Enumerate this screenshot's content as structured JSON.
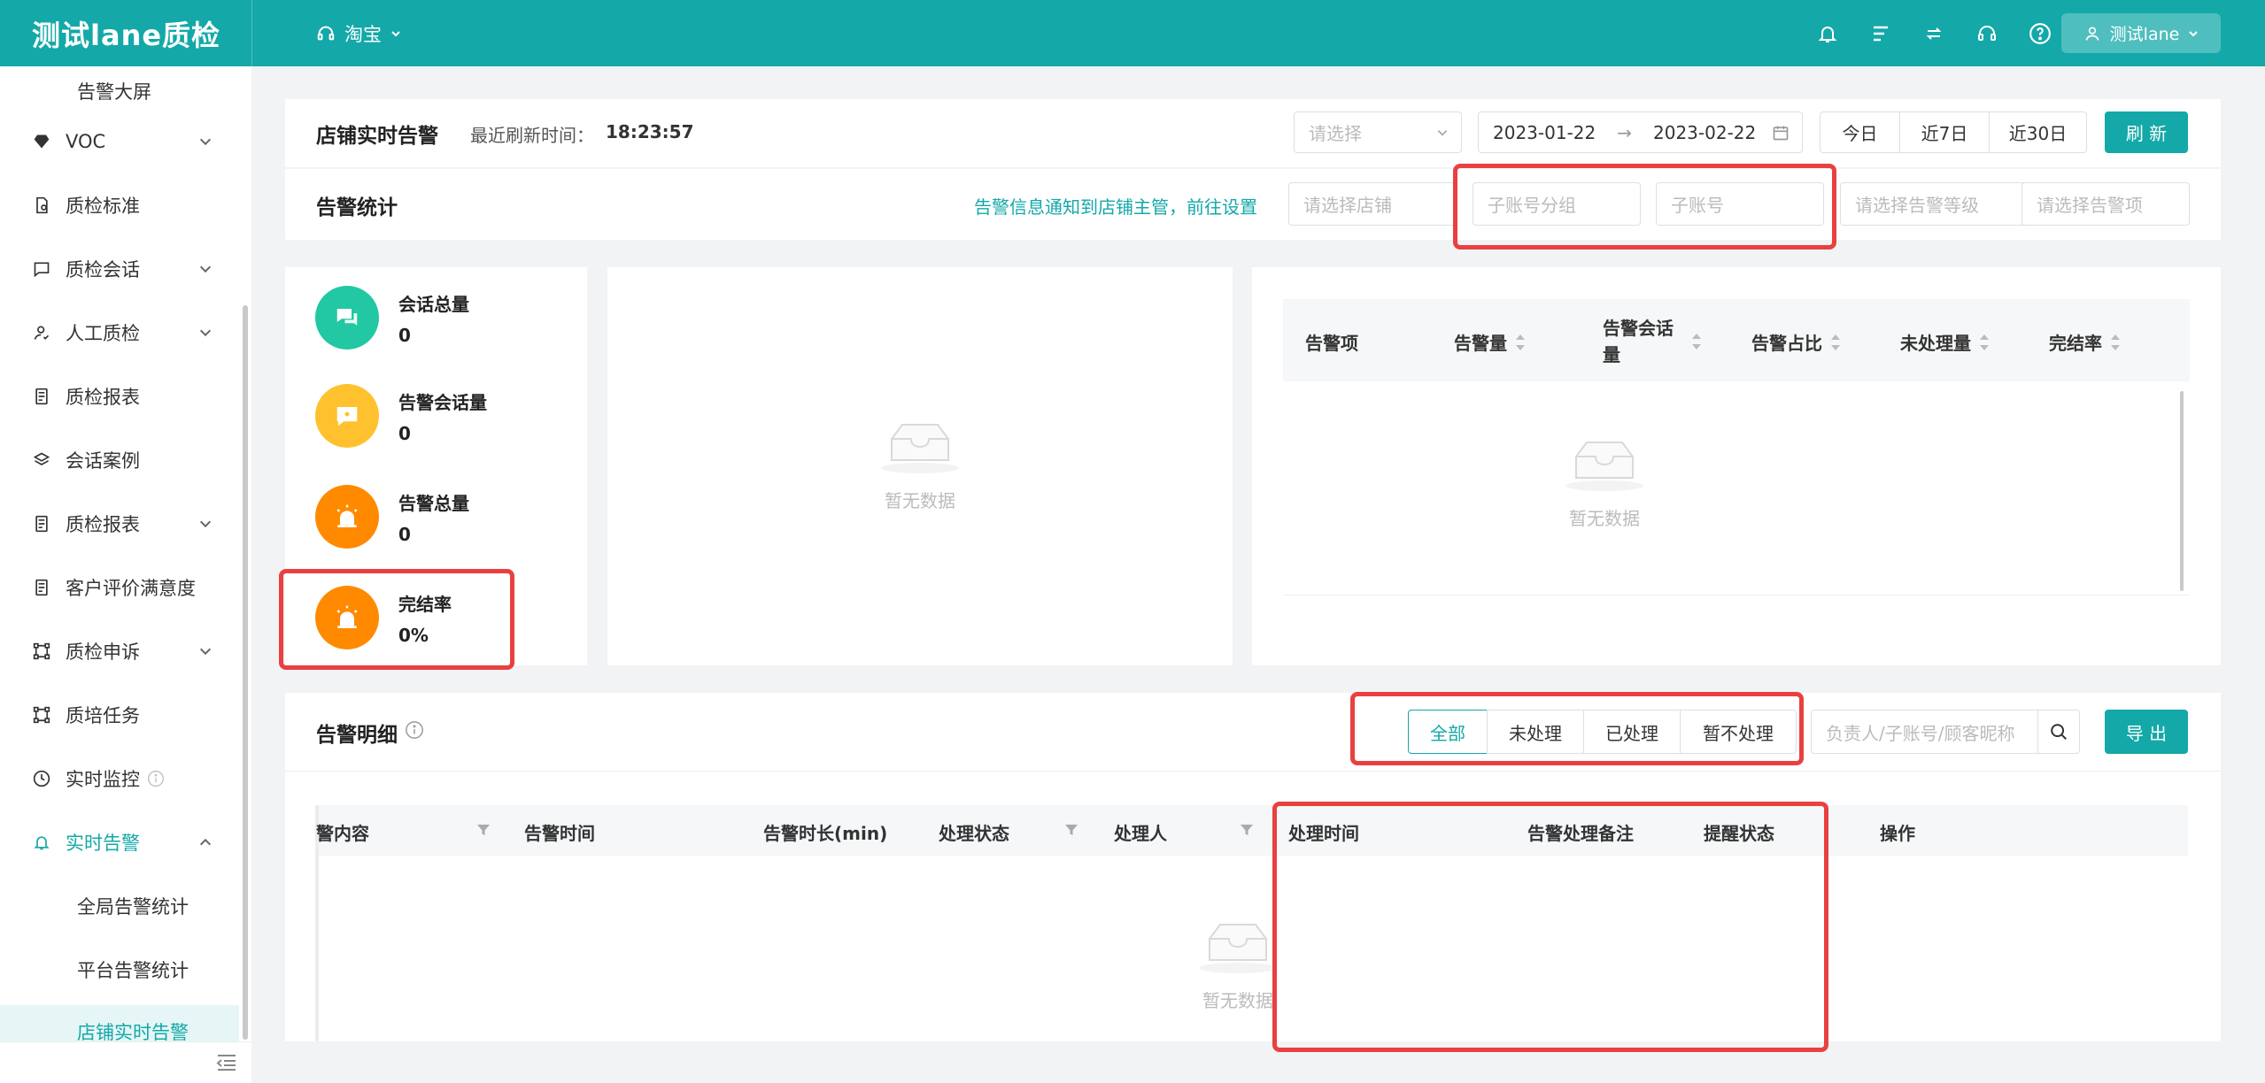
{
  "header": {
    "app_title": "测试lane质检",
    "platform": "淘宝",
    "user": "测试lane"
  },
  "sidebar": {
    "items": [
      {
        "label": "告警大屏"
      },
      {
        "label": "VOC"
      },
      {
        "label": "质检标准"
      },
      {
        "label": "质检会话"
      },
      {
        "label": "人工质检"
      },
      {
        "label": "质检报表"
      },
      {
        "label": "会话案例"
      },
      {
        "label": "质检报表"
      },
      {
        "label": "客户评价满意度"
      },
      {
        "label": "质检申诉"
      },
      {
        "label": "质培任务"
      },
      {
        "label": "实时监控"
      },
      {
        "label": "实时告警"
      },
      {
        "label": "全局告警统计"
      },
      {
        "label": "平台告警统计"
      },
      {
        "label": "店铺实时告警"
      }
    ]
  },
  "toolbar": {
    "title": "店铺实时告警",
    "refresh_time_label": "最近刷新时间：",
    "refresh_time": "18:23:57",
    "select_placeholder": "请选择",
    "date_start": "2023-01-22",
    "date_arrow": "→",
    "date_end": "2023-02-22",
    "quick": [
      "今日",
      "近7日",
      "近30日"
    ],
    "refresh_btn": "刷 新"
  },
  "stats_header": {
    "title": "告警统计",
    "notice_link": "告警信息通知到店铺主管，前往设置",
    "filters": [
      "请选择店铺",
      "子账号分组",
      "子账号",
      "请选择告警等级",
      "请选择告警项"
    ]
  },
  "stats": [
    {
      "label": "会话总量",
      "value": "0",
      "color": "#22c7a3"
    },
    {
      "label": "告警会话量",
      "value": "0",
      "color": "#ffc22e"
    },
    {
      "label": "告警总量",
      "value": "0",
      "color": "#ff8a00"
    },
    {
      "label": "完结率",
      "value": "0%",
      "color": "#ff8a00"
    }
  ],
  "empty_text": "暂无数据",
  "alert_table": {
    "headers": [
      "告警项",
      "告警量",
      "告警会话量",
      "告警占比",
      "未处理量",
      "完结率"
    ]
  },
  "detail": {
    "title": "告警明细",
    "tabs": [
      "全部",
      "未处理",
      "已处理",
      "暂不处理"
    ],
    "search_placeholder": "负责人/子账号/顾客昵称",
    "export_btn": "导 出",
    "columns": [
      "警内容",
      "告警时间",
      "告警时长(min)",
      "处理状态",
      "处理人",
      "处理时间",
      "告警处理备注",
      "提醒状态",
      "操作"
    ]
  },
  "colors": {
    "brand": "#14a8a8",
    "highlight": "#e94040"
  }
}
